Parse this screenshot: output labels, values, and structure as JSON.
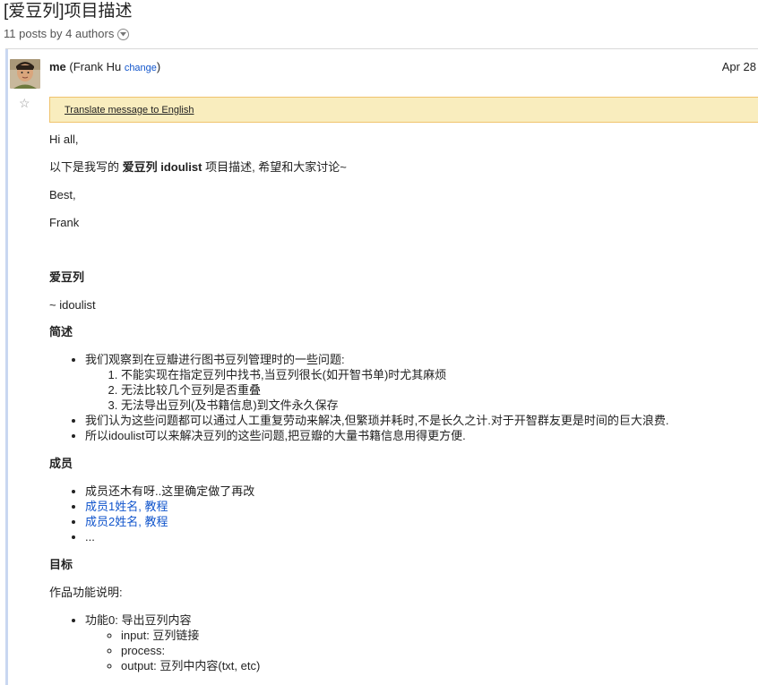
{
  "thread": {
    "title": "[爱豆列]项目描述",
    "meta": "11 posts by 4 authors"
  },
  "post": {
    "author_name": "me",
    "author_full": " (Frank Hu ",
    "change_label": "change",
    "author_close": ")",
    "date": "Apr 28",
    "translate_label": "Translate message to English",
    "greeting": "Hi all,",
    "intro_prefix": "以下是我写的 ",
    "intro_bold": "爱豆列 idoulist",
    "intro_suffix": " 项目描述, 希望和大家讨论~",
    "sign_best": "Best,",
    "sign_name": "Frank",
    "project_title": "爱豆列",
    "project_subtitle": "~ idoulist",
    "section_summary": "简述",
    "summary_items": [
      "我们观察到在豆瓣进行图书豆列管理时的一些问题:",
      "我们认为这些问题都可以通过人工重复劳动来解决,但繁琐并耗时,不是长久之计.对于开智群友更是时间的巨大浪费.",
      "所以idoulist可以来解决豆列的这些问题,把豆瓣的大量书籍信息用得更方便."
    ],
    "summary_subitems": [
      "不能实现在指定豆列中找书,当豆列很长(如开智书单)时尤其麻烦",
      "无法比较几个豆列是否重叠",
      "无法导出豆列(及书籍信息)到文件永久保存"
    ],
    "section_members": "成员",
    "members_note": "成员还木有呀..这里确定做了再改",
    "member1_name": "成员1姓名",
    "member1_sep": ", ",
    "member1_link": "教程",
    "member2_name": "成员2姓名",
    "member2_sep": ", ",
    "member2_link": "教程",
    "members_more": "...",
    "section_goals": "目标",
    "goals_intro": "作品功能说明:",
    "feature0": "功能0: 导出豆列内容",
    "feature0_items": [
      "input: 豆列链接",
      "process:",
      "output: 豆列中内容(txt, etc)"
    ]
  },
  "colors": {
    "link": "#1155cc",
    "translate_bg": "#f9edbe",
    "translate_border": "#f0c36d"
  }
}
